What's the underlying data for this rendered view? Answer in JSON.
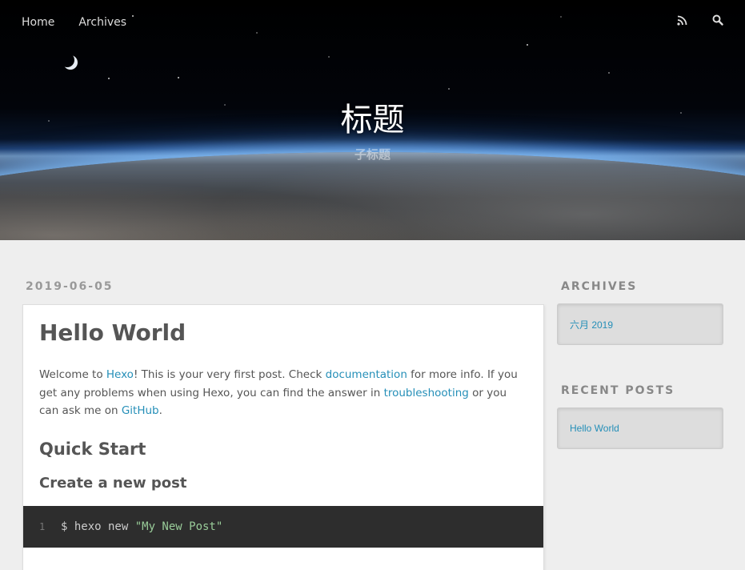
{
  "nav": {
    "links": [
      "Home",
      "Archives"
    ],
    "icons": [
      "rss-icon",
      "search-icon"
    ]
  },
  "banner": {
    "title": "标题",
    "subtitle": "子标题"
  },
  "post": {
    "date": "2019-06-05",
    "title": "Hello World",
    "intro": {
      "t1": "Welcome to ",
      "link_hexo": "Hexo",
      "t2": "! This is your very first post. Check ",
      "link_docs": "documentation",
      "t3": " for more info. If you get any problems when using Hexo, you can find the answer in ",
      "link_trouble": "troubleshooting",
      "t4": " or you can ask me on ",
      "link_github": "GitHub",
      "t5": "."
    },
    "h_quick_start": "Quick Start",
    "h_create_post": "Create a new post",
    "code": {
      "line_no": "1",
      "cmd": "$ hexo new ",
      "arg": "\"My New Post\""
    }
  },
  "sidebar": {
    "archives_title": "Archives",
    "archives_items": [
      "六月 2019"
    ],
    "recent_title": "Recent Posts",
    "recent_items": [
      "Hello World"
    ]
  },
  "colors": {
    "link": "#258fb8",
    "background": "#eeeeee",
    "code_bg": "#2d2d2d"
  }
}
